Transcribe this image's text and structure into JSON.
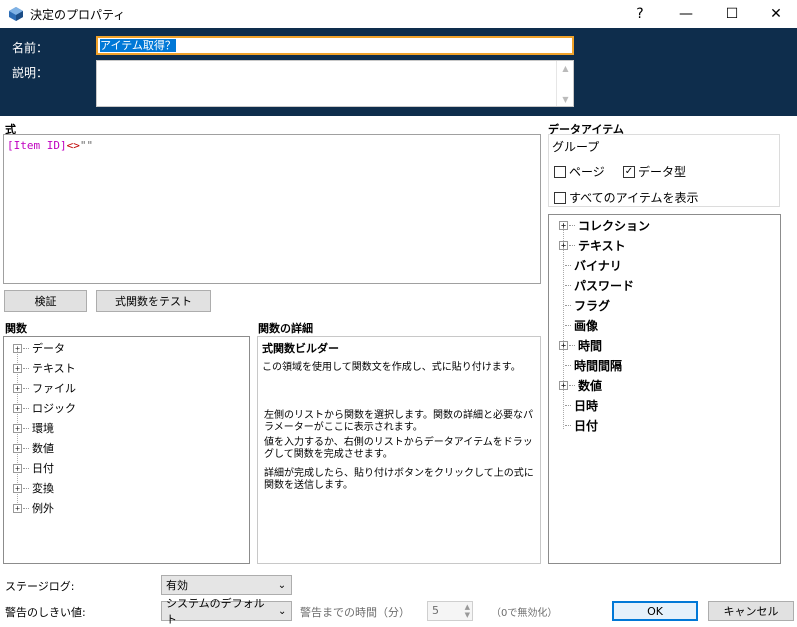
{
  "window": {
    "title": "決定のプロパティ",
    "help": "?",
    "minimize": "—",
    "maximize": "☐",
    "close": "✕"
  },
  "header": {
    "name_label": "名前：",
    "name_value": "アイテム取得？",
    "description_label": "説明：",
    "description_value": ""
  },
  "expression": {
    "label": "式",
    "field": "[Item ID]",
    "operator": "<>",
    "literal": "\"\""
  },
  "buttons": {
    "validate": "検証",
    "test": "式関数をテスト",
    "ok": "OK",
    "cancel": "キャンセル"
  },
  "functions": {
    "label": "関数",
    "items": [
      "データ",
      "テキスト",
      "ファイル",
      "ロジック",
      "環境",
      "数値",
      "日付",
      "変換",
      "例外"
    ]
  },
  "details": {
    "label": "関数の詳細",
    "heading": "式関数ビルダー",
    "p1": "この領域を使用して関数文を作成し、式に貼り付けます。",
    "p2": "左側のリストから関数を選択します。関数の詳細と必要なパラメーターがここに表示されます。",
    "p3": "値を入力するか、右側のリストからデータアイテムをドラッグして関数を完成させます。",
    "p4": "詳細が完成したら、貼り付けボタンをクリックして上の式に関数を送信します。"
  },
  "data_items": {
    "label": "データアイテム",
    "group_label": "グループ",
    "page_checkbox": "ページ",
    "page_checked": false,
    "datatype_checkbox": "データ型",
    "datatype_checked": true,
    "show_all_checkbox": "すべてのアイテムを表示",
    "show_all_checked": false,
    "tree": [
      {
        "label": "コレクション",
        "expandable": true
      },
      {
        "label": "テキスト",
        "expandable": true
      },
      {
        "label": "バイナリ",
        "expandable": false
      },
      {
        "label": "パスワード",
        "expandable": false
      },
      {
        "label": "フラグ",
        "expandable": false
      },
      {
        "label": "画像",
        "expandable": false
      },
      {
        "label": "時間",
        "expandable": true
      },
      {
        "label": "時間間隔",
        "expandable": false
      },
      {
        "label": "数値",
        "expandable": true
      },
      {
        "label": "日時",
        "expandable": false
      },
      {
        "label": "日付",
        "expandable": false
      }
    ]
  },
  "footer": {
    "stage_log_label": "ステージログ:",
    "stage_log_value": "有効",
    "warning_label": "警告のしきい値:",
    "warning_value": "システムのデフォルト",
    "warning_time_label": "警告までの時間（分）",
    "warning_time_value": "5",
    "disable_hint": "（0で無効化）"
  },
  "colors": {
    "header_bg": "#0e2d4c",
    "focus_border": "#f0a22a",
    "selection": "#0078d7",
    "expr_field": "#c000c0",
    "expr_operator": "#c00000"
  }
}
